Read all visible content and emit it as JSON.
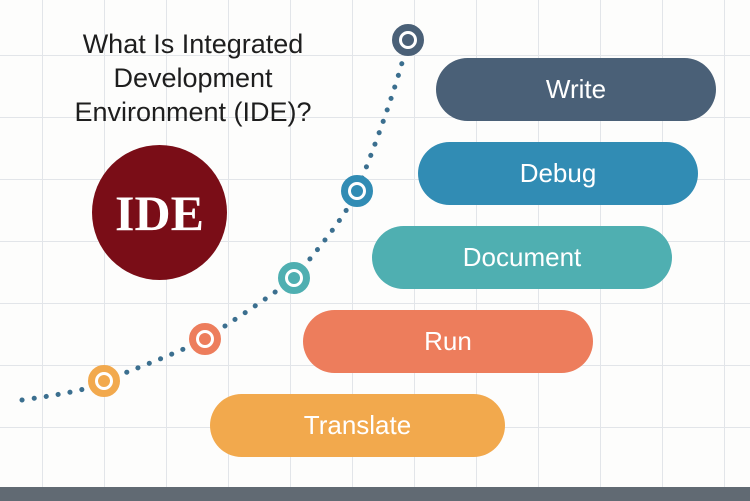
{
  "title": "What Is Integrated Development Environment (IDE)?",
  "badge": "IDE",
  "pills": {
    "write": "Write",
    "debug": "Debug",
    "document": "Document",
    "run": "Run",
    "translate": "Translate"
  },
  "colors": {
    "write": "#4a6077",
    "debug": "#318cb4",
    "document": "#4fafb1",
    "run": "#ed7d5c",
    "translate": "#f2a94d",
    "badge_bg": "#7a0d17"
  }
}
